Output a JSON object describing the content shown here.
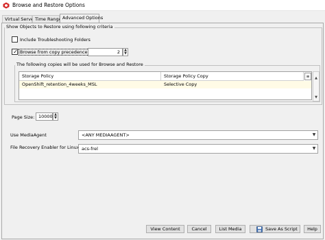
{
  "window": {
    "title": "Browse and Restore Options",
    "icon": "commvault-app-icon"
  },
  "tabs": [
    {
      "label": "Virtual Server"
    },
    {
      "label": "Time Range"
    },
    {
      "label": "Advanced Options",
      "active": true
    }
  ],
  "show_objects": {
    "legend": "Show Objects to Restore using following criteria",
    "include_troubleshooting": {
      "label": "Include Troubleshooting Folders",
      "checked": false
    },
    "browse_from_copy": {
      "label": "Browse from copy precedence:",
      "checked": true,
      "value": "2"
    },
    "copies_group": {
      "legend": "The following copies will be used for Browse and Restore",
      "columns": [
        "Storage Policy",
        "Storage Policy Copy"
      ],
      "rows": [
        [
          "OpenShift_retention_4weeks_MSL",
          "Selective Copy"
        ]
      ]
    }
  },
  "page_size": {
    "label": "Page Size:",
    "value": "10000"
  },
  "media_agent": {
    "label": "Use MediaAgent",
    "value": "<ANY MEDIAAGENT>"
  },
  "file_recovery": {
    "label": "File Recovery Enabler for Linux:",
    "value": "acs-frel"
  },
  "buttons": {
    "view_content": "View Content",
    "cancel": "Cancel",
    "list_media": "List Media",
    "save_as_script": "Save As Script",
    "help": "Help"
  },
  "colors": {
    "accent_red": "#d62a2a",
    "selected_row": "#fffbe6",
    "background": "#f0f0f0"
  }
}
